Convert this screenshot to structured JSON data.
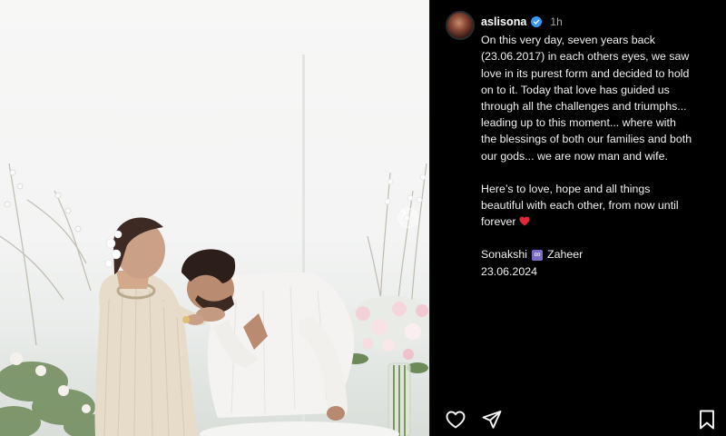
{
  "post": {
    "username": "aslisona",
    "time": "1h",
    "caption_lines": [
      "On this very day, seven years back",
      "(23.06.2017) in each others eyes, we saw",
      "love in its purest form and decided to hold",
      "on to it. Today that love has guided us",
      "through all the challenges and triumphs...",
      "leading up to this moment... where with",
      "the blessings of both our families and both",
      "our gods... we are now man and wife."
    ],
    "caption2_lines": [
      "Here’s to love, hope and all things",
      "beautiful with each other, from now until",
      "forever"
    ],
    "signature": {
      "name1": "Sonakshi",
      "infinity": "∞",
      "name2": "Zaheer",
      "date": "23.06.2024"
    }
  },
  "icons": {
    "verified": "verified-badge-icon",
    "like": "heart-icon",
    "share": "send-icon",
    "save": "bookmark-icon",
    "carousel": "chevron-right-icon",
    "emoji": "red-heart-emoji"
  },
  "colors": {
    "panel_bg": "#000000",
    "verified": "#3897f0",
    "heart_emoji": "#d32f2f"
  }
}
